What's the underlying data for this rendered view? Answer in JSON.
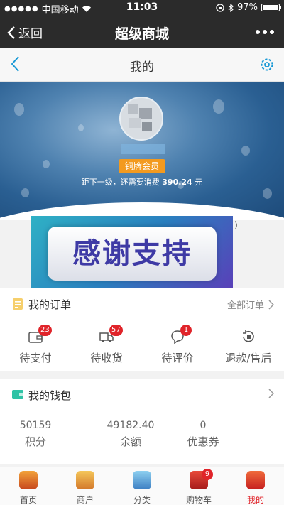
{
  "status_bar": {
    "carrier": "中国移动",
    "time": "11:03",
    "battery": "97%"
  },
  "wechat_bar": {
    "back_label": "返回",
    "title": "超级商城"
  },
  "page_header": {
    "title": "我的"
  },
  "profile": {
    "level_badge": "铜牌会员",
    "next_level_text": "距下一级，还需要消费",
    "next_level_amount": "390.24",
    "next_level_unit": "元"
  },
  "support_banner": {
    "text": "感谢支持",
    "edge_mark": ")"
  },
  "orders": {
    "title": "我的订单",
    "all_label": "全部订单",
    "items": [
      {
        "label": "待支付",
        "count": "23"
      },
      {
        "label": "待收货",
        "count": "57"
      },
      {
        "label": "待评价",
        "count": "1"
      },
      {
        "label": "退款/售后",
        "count": ""
      }
    ]
  },
  "wallet": {
    "title": "我的钱包",
    "items": [
      {
        "value": "50159",
        "label": "积分"
      },
      {
        "value": "49182.40",
        "label": "余额"
      },
      {
        "value": "0",
        "label": "优惠券"
      }
    ]
  },
  "tabs": [
    {
      "label": "首页",
      "icon": "home-icon",
      "badge": ""
    },
    {
      "label": "商户",
      "icon": "merchant-icon",
      "badge": ""
    },
    {
      "label": "分类",
      "icon": "category-icon",
      "badge": ""
    },
    {
      "label": "购物车",
      "icon": "cart-icon",
      "badge": "9"
    },
    {
      "label": "我的",
      "icon": "profile-icon",
      "badge": ""
    }
  ],
  "colors": {
    "accent": "#e0242a",
    "badge": "#f39a1f",
    "icon_blue": "#1a9ad6",
    "nav_bg": "#2b2b2b"
  }
}
